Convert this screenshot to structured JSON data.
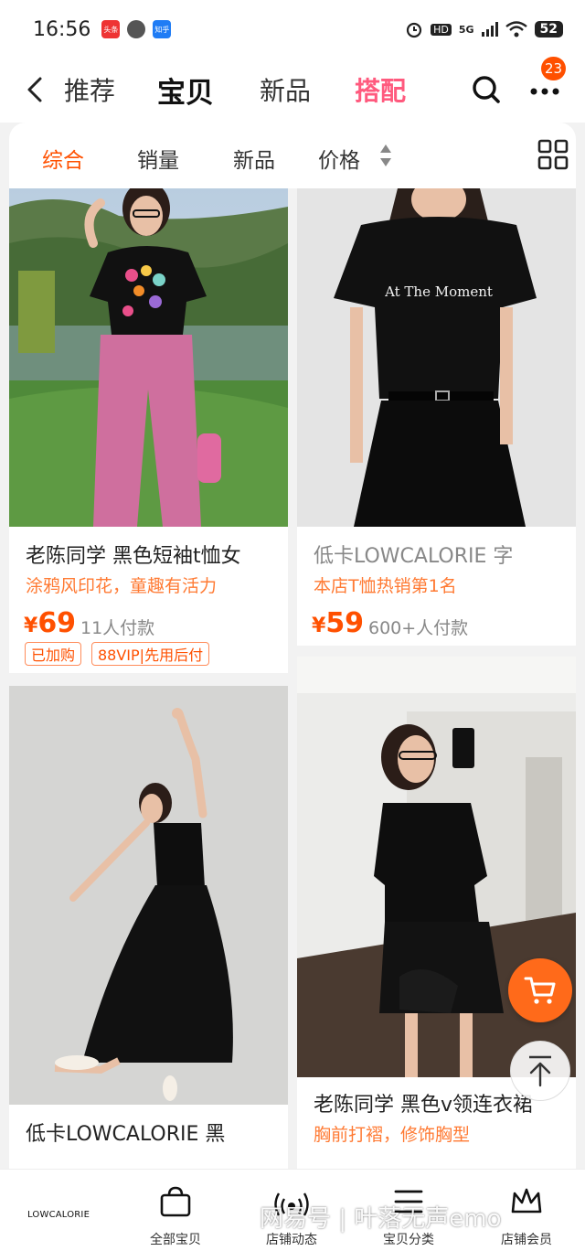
{
  "status": {
    "time": "16:56",
    "apps": [
      "头条",
      "",
      "知乎"
    ],
    "network": "HD",
    "signal": "5G",
    "battery": "52"
  },
  "nav": {
    "tabs": [
      "推荐",
      "宝贝",
      "新品",
      "搭配"
    ],
    "active_tab": "宝贝",
    "highlight_tab": "搭配",
    "badge": "23"
  },
  "filters": {
    "items": [
      "综合",
      "销量",
      "新品",
      "价格"
    ],
    "active": "综合"
  },
  "products": [
    {
      "title": "老陈同学 黑色短袖t恤女",
      "subtitle": "涂鸦风印花，童趣有活力",
      "price_symbol": "¥",
      "price": "69",
      "sold": "11人付款",
      "tags": [
        "已加购",
        "88VIP|先用后付"
      ]
    },
    {
      "title": "低卡LOWCALORIE 字",
      "subtitle": "本店T恤热销第1名",
      "price_symbol": "¥",
      "price": "59",
      "sold": "600+人付款",
      "tags": [],
      "print_text": "At The Moment"
    },
    {
      "title": "低卡LOWCALORIE 黑",
      "subtitle": "",
      "price_symbol": "",
      "price": "",
      "sold": "",
      "tags": []
    },
    {
      "title": "老陈同学 黑色v领连衣裙",
      "subtitle": "胸前打褶，修饰胸型",
      "price_symbol": "",
      "price": "",
      "sold": "",
      "tags": []
    }
  ],
  "bottom": {
    "brand": "LOWCALORIE",
    "items": [
      "全部宝贝",
      "店铺动态",
      "宝贝分类",
      "店铺会员"
    ]
  },
  "watermark": "网易号 | 叶落无声emo",
  "colors": {
    "accent": "#ff5000",
    "pink": "#ff5a7e",
    "subtitle": "#ff7a33"
  },
  "icons": [
    "back-arrow-icon",
    "search-icon",
    "more-icon",
    "sort-arrows-icon",
    "grid-toggle-icon",
    "cart-icon",
    "back-to-top-icon",
    "bag-icon",
    "broadcast-icon",
    "list-icon",
    "crown-icon"
  ]
}
